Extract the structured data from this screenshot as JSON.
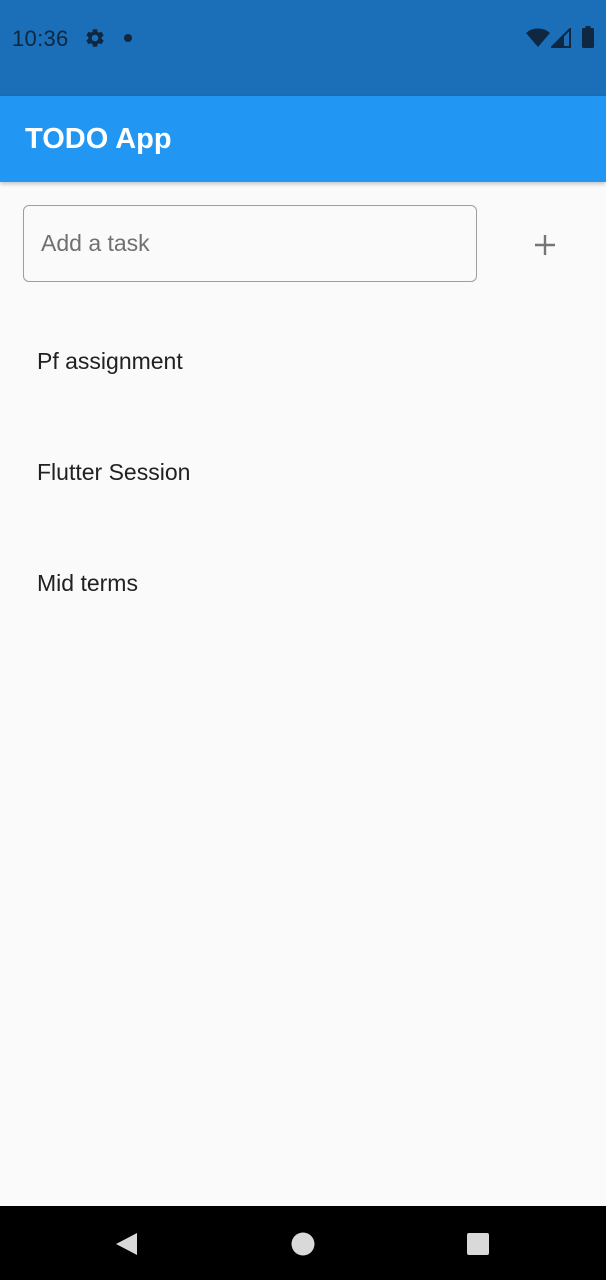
{
  "status_bar": {
    "time": "10:36",
    "icons": [
      "gear-icon",
      "notification-dot-icon",
      "wifi-icon",
      "signal-icon",
      "battery-icon"
    ],
    "background": "#1a6fb8"
  },
  "app_bar": {
    "title": "TODO App",
    "background": "#2196f3"
  },
  "task_input": {
    "value": "",
    "placeholder": "Add a task"
  },
  "add_button": {
    "icon": "plus-icon"
  },
  "tasks": [
    {
      "label": "Pf assignment"
    },
    {
      "label": "Flutter Session"
    },
    {
      "label": "Mid terms"
    }
  ],
  "nav_bar": {
    "icons": [
      "back-icon",
      "home-icon",
      "recents-icon"
    ],
    "background": "#000000"
  }
}
